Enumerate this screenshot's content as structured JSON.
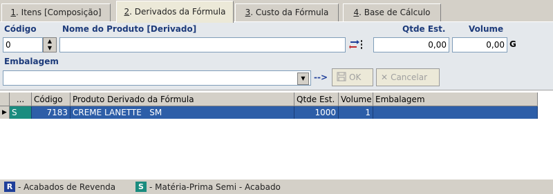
{
  "tabs": [
    {
      "key": "1",
      "label": ". Itens [Composição]"
    },
    {
      "key": "2",
      "label": ". Derivados da Fórmula"
    },
    {
      "key": "3",
      "label": ". Custo da Fórmula"
    },
    {
      "key": "4",
      "label": ". Base de Cálculo"
    }
  ],
  "form": {
    "codigo_label": "Código",
    "codigo_value": "0",
    "nome_label": "Nome do Produto [Derivado]",
    "nome_value": "",
    "qtde_label": "Qtde Est.",
    "qtde_value": "0,00",
    "volume_label": "Volume",
    "volume_value": "0,00",
    "volume_unit": "G",
    "embalagem_label": "Embalagem",
    "embalagem_value": "",
    "arrow": "-->",
    "ok_label": "OK",
    "cancel_label": "Cancelar"
  },
  "grid": {
    "headers": [
      "...",
      "Código",
      "Produto Derivado da Fórmula",
      "Qtde Est.",
      "Volume",
      "Embalagem"
    ],
    "rows": [
      {
        "tipo": "S",
        "codigo": "7183",
        "produto": "CREME LANETTE   SM",
        "qtde": "1000",
        "volume": "1",
        "embalagem": ""
      }
    ]
  },
  "legend": [
    {
      "badge": "R",
      "text": "- Acabados de Revenda",
      "color": "#1f3f9a"
    },
    {
      "badge": "S",
      "text": "- Matéria-Prima Semi - Acabado",
      "color": "#1a8c7f"
    }
  ],
  "colors": {
    "selected_row": "#2d5ea8",
    "label_blue": "#1c3a7a"
  }
}
